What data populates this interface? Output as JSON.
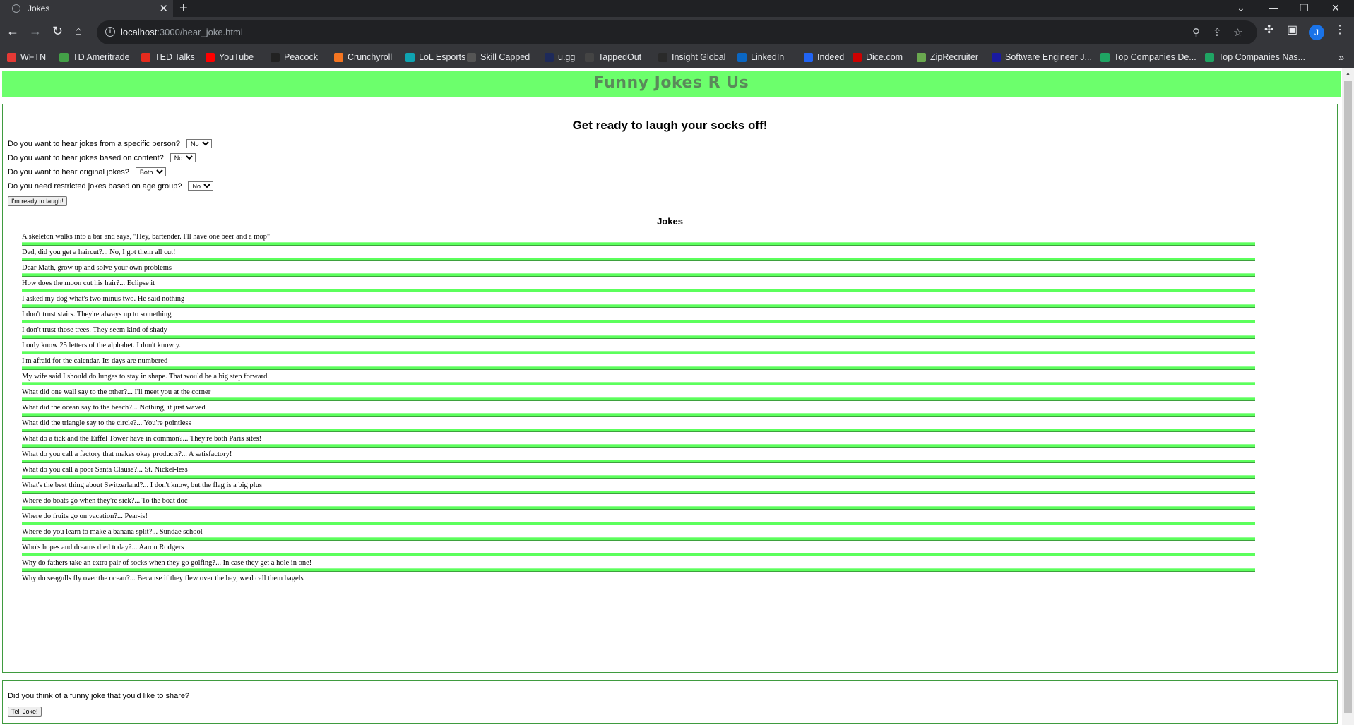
{
  "browser": {
    "tab_title": "Jokes",
    "url_host": "localhost",
    "url_path": ":3000/hear_joke.html",
    "profile_initial": "J",
    "bookmarks": [
      {
        "label": "WFTN",
        "color": "#e53935"
      },
      {
        "label": "TD Ameritrade",
        "color": "#43a047"
      },
      {
        "label": "TED Talks",
        "color": "#e62b1e"
      },
      {
        "label": "YouTube",
        "color": "#ff0000"
      },
      {
        "label": "Peacock",
        "color": "#222222"
      },
      {
        "label": "Crunchyroll",
        "color": "#f47521"
      },
      {
        "label": "LoL Esports",
        "color": "#0fa3b1"
      },
      {
        "label": "Skill Capped",
        "color": "#555555"
      },
      {
        "label": "u.gg",
        "color": "#1e2a5a"
      },
      {
        "label": "TappedOut",
        "color": "#444444"
      },
      {
        "label": "Insight Global",
        "color": "#2a2a2a"
      },
      {
        "label": "LinkedIn",
        "color": "#0a66c2"
      },
      {
        "label": "Indeed",
        "color": "#2164f3"
      },
      {
        "label": "Dice.com",
        "color": "#cc0000"
      },
      {
        "label": "ZipRecruiter",
        "color": "#6aa84f"
      },
      {
        "label": "Software Engineer J...",
        "color": "#1a1aa0"
      },
      {
        "label": "Top Companies De...",
        "color": "#1fa463"
      },
      {
        "label": "Top Companies Nas...",
        "color": "#1fa463"
      }
    ]
  },
  "page": {
    "header_title": "Funny Jokes R Us",
    "heading": "Get ready to laugh your socks off!",
    "questions": [
      {
        "label": "Do you want to hear jokes from a specific person?",
        "value": "No"
      },
      {
        "label": "Do you want to hear jokes based on content?",
        "value": "No"
      },
      {
        "label": "Do you want to hear original jokes?",
        "value": "Both"
      },
      {
        "label": "Do you need restricted jokes based on age group?",
        "value": "No"
      }
    ],
    "laugh_button": "I'm ready to laugh!",
    "jokes_title": "Jokes",
    "jokes": [
      "A skeleton walks into a bar and says, \"Hey, bartender. I'll have one beer and a mop\"",
      "Dad, did you get a haircut?... No, I got them all cut!",
      "Dear Math, grow up and solve your own problems",
      "How does the moon cut his hair?... Eclipse it",
      "I asked my dog what's two minus two. He said nothing",
      "I don't trust stairs. They're always up to something",
      "I don't trust those trees. They seem kind of shady",
      "I only know 25 letters of the alphabet. I don't know y.",
      "I'm afraid for the calendar. Its days are numbered",
      "My wife said I should do lunges to stay in shape. That would be a big step forward.",
      "What did one wall say to the other?... I'll meet you at the corner",
      "What did the ocean say to the beach?... Nothing, it just waved",
      "What did the triangle say to the circle?... You're pointless",
      "What do a tick and the Eiffel Tower have in common?... They're both Paris sites!",
      "What do you call a factory that makes okay products?... A satisfactory!",
      "What do you call a poor Santa Clause?... St. Nickel-less",
      "What's the best thing about Switzerland?... I don't know, but the flag is a big plus",
      "Where do boats go when they're sick?... To the boat doc",
      "Where do fruits go on vacation?... Pear-is!",
      "Where do you learn to make a banana split?... Sundae school",
      "Who's hopes and dreams died today?... Aaron Rodgers",
      "Why do fathers take an extra pair of socks when they go golfing?... In case they get a hole in one!",
      "Why do seagulls fly over the ocean?... Because if they flew over the bay, we'd call them bagels"
    ],
    "share_question": "Did you think of a funny joke that you'd like to share?",
    "tell_button": "Tell Joke!"
  }
}
